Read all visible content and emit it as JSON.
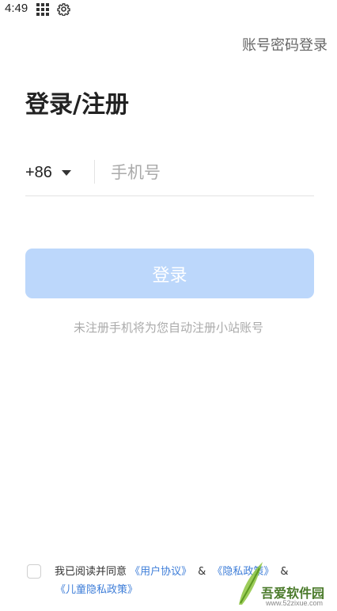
{
  "status_bar": {
    "time": "4:49",
    "icons": [
      "grid-icon",
      "gear-icon"
    ]
  },
  "header": {
    "password_login": "账号密码登录"
  },
  "title": "登录/注册",
  "phone": {
    "country_code": "+86",
    "placeholder": "手机号",
    "value": ""
  },
  "login_button": {
    "label": "登录",
    "color": "#bcd7fb"
  },
  "register_hint": "未注册手机将为您自动注册小站账号",
  "agreement": {
    "prefix": "我已阅读并同意",
    "user_agreement": "《用户协议》",
    "amp": "&",
    "privacy_policy": "《隐私政策》",
    "child_privacy_policy": "《儿童隐私政策》",
    "checked": false,
    "link_color": "#3d7dd8"
  },
  "watermark": {
    "text": "吾爱软件园",
    "url": "www.52zixue.com"
  }
}
